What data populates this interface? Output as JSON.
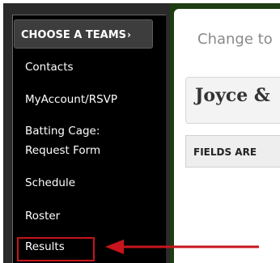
{
  "sidebar": {
    "choose_team_label": "CHOOSE A TEAMS",
    "choose_team_chevron": "›",
    "items": [
      {
        "label": "Contacts"
      },
      {
        "label": "MyAccount/RSVP"
      },
      {
        "label": "Batting Cage:"
      },
      {
        "label": "Request Form"
      },
      {
        "label": "Schedule"
      },
      {
        "label": "Roster"
      },
      {
        "label": "Results"
      }
    ]
  },
  "main": {
    "change_team_text": "Change to",
    "team_name": "Joyce &",
    "fields_notice": "FIELDS ARE"
  },
  "colors": {
    "highlight": "#c8141c",
    "sidebar_bg": "#000000",
    "frame_green": "#1e3d12"
  }
}
